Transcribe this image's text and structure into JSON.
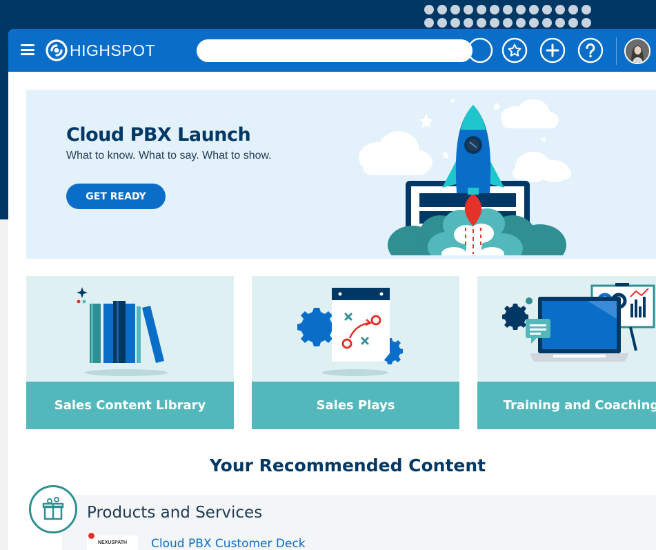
{
  "header": {
    "logo_text": "HIGHSPOT",
    "search_placeholder": "",
    "icons": [
      "search-icon",
      "star-icon",
      "plus-icon",
      "help-icon"
    ]
  },
  "hero": {
    "title": "Cloud PBX Launch",
    "subtitle": "What to know. What to say. What to show.",
    "button_label": "GET READY"
  },
  "cards": [
    {
      "label": "Sales Content Library"
    },
    {
      "label": "Sales Plays"
    },
    {
      "label": "Training and Coaching"
    }
  ],
  "recommended": {
    "heading": "Your Recommended Content",
    "category": "Products and Services",
    "items": [
      {
        "thumb_label": "NEXUSPATH",
        "title": "Cloud PBX Customer Deck"
      }
    ]
  },
  "colors": {
    "brand_dark": "#003865",
    "brand_blue": "#0a6ec9",
    "teal": "#53b8bc",
    "card_bg": "#dff0f2",
    "hero_bg": "#e3f1fb"
  }
}
